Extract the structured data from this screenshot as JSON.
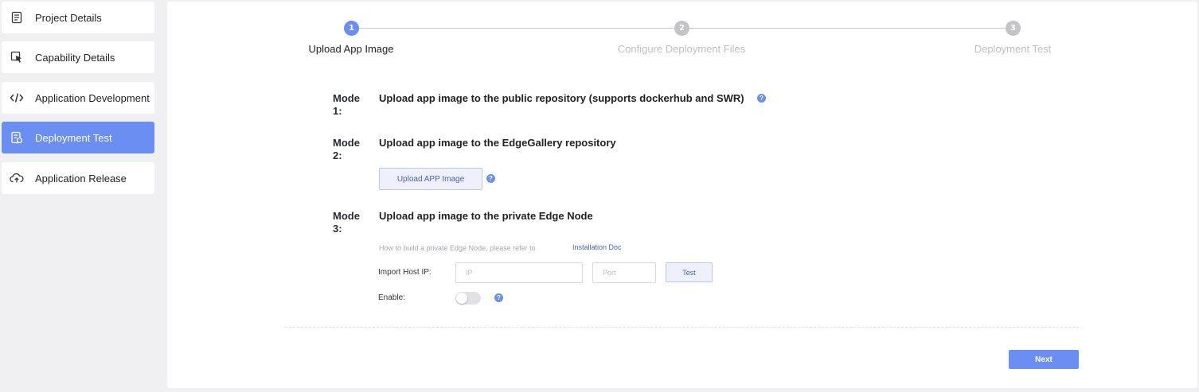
{
  "sidebar": {
    "items": [
      {
        "label": "Project Details",
        "icon": "document-icon"
      },
      {
        "label": "Capability Details",
        "icon": "cursor-icon"
      },
      {
        "label": "Application Development",
        "icon": "code-icon"
      },
      {
        "label": "Deployment Test",
        "icon": "test-document-icon",
        "active": true
      },
      {
        "label": "Application Release",
        "icon": "cloud-upload-icon"
      }
    ]
  },
  "stepper": {
    "steps": [
      {
        "number": "1",
        "label": "Upload App Image",
        "active": true
      },
      {
        "number": "2",
        "label": "Configure Deployment Files",
        "active": false
      },
      {
        "number": "3",
        "label": "Deployment Test",
        "active": false
      }
    ]
  },
  "modes": [
    {
      "tag": "Mode 1:",
      "title": "Upload app image to the public repository (supports dockerhub and SWR)"
    },
    {
      "tag": "Mode 2:",
      "title": "Upload app image to the EdgeGallery repository"
    },
    {
      "tag": "Mode 3:",
      "title": "Upload app image to the private Edge Node"
    }
  ],
  "upload_button": "Upload APP Image",
  "help_glyph": "?",
  "private_node": {
    "hint": "How to build a private Edge Node, please refer to",
    "link": "Installation Doc",
    "import_label": "Import Host IP:",
    "ip_placeholder": "IP",
    "port_placeholder": "Port",
    "test_button": "Test",
    "enable_label": "Enable:",
    "enabled": false
  },
  "next_button": "Next",
  "colors": {
    "accent": "#6a8ef2",
    "inactive_step": "#c4c4c8"
  }
}
